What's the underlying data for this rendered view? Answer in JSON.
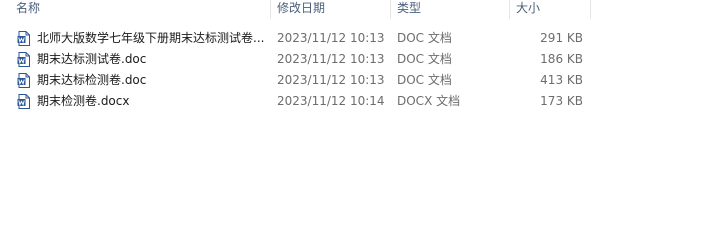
{
  "columns": {
    "name": "名称",
    "date": "修改日期",
    "type": "类型",
    "size": "大小"
  },
  "files": [
    {
      "name": "北师大版数学七年级下册期末达标测试卷...",
      "date": "2023/11/12 10:13",
      "type": "DOC 文档",
      "size": "291 KB",
      "icon": "word-doc-icon"
    },
    {
      "name": "期末达标测试卷.doc",
      "date": "2023/11/12 10:13",
      "type": "DOC 文档",
      "size": "186 KB",
      "icon": "word-doc-icon"
    },
    {
      "name": "期末达标检测卷.doc",
      "date": "2023/11/12 10:13",
      "type": "DOC 文档",
      "size": "413 KB",
      "icon": "word-doc-icon"
    },
    {
      "name": "期末检测卷.docx",
      "date": "2023/11/12 10:14",
      "type": "DOCX 文档",
      "size": "173 KB",
      "icon": "word-docx-icon"
    }
  ],
  "colors": {
    "header_text": "#4c607a",
    "word_blue": "#2b5797"
  }
}
